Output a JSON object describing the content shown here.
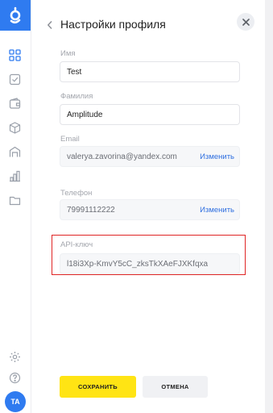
{
  "colors": {
    "accent": "#2f7bf0",
    "save": "#ffe414",
    "highlight": "#e02525",
    "link": "#2f6fe0"
  },
  "sidebar": {
    "logo_icon": "app-logo-icon",
    "items": [
      {
        "icon": "grid-icon"
      },
      {
        "icon": "checkbox-icon"
      },
      {
        "icon": "wallet-icon"
      },
      {
        "icon": "box-icon"
      },
      {
        "icon": "warehouse-icon"
      },
      {
        "icon": "chart-icon"
      },
      {
        "icon": "folder-icon"
      }
    ],
    "settings_icon": "gear-icon",
    "help_icon": "help-icon",
    "avatar_initials": "TA"
  },
  "header": {
    "title": "Настройки профиля",
    "back_icon": "chevron-left-icon",
    "close_icon": "close-icon"
  },
  "form": {
    "first_name": {
      "label": "Имя",
      "value": "Test"
    },
    "last_name": {
      "label": "Фамилия",
      "value": "Amplitude"
    },
    "email": {
      "label": "Email",
      "value": "valerya.zavorina@yandex.com",
      "action": "Изменить"
    },
    "phone": {
      "label": "Телефон",
      "value": "79991112222",
      "action": "Изменить"
    },
    "api_key": {
      "label": "API-ключ",
      "value": "l18i3Xp-KmvY5cC_zksTkXAeFJXKfqxa"
    }
  },
  "buttons": {
    "save": "СОХРАНИТЬ",
    "cancel": "ОТМЕНА"
  }
}
